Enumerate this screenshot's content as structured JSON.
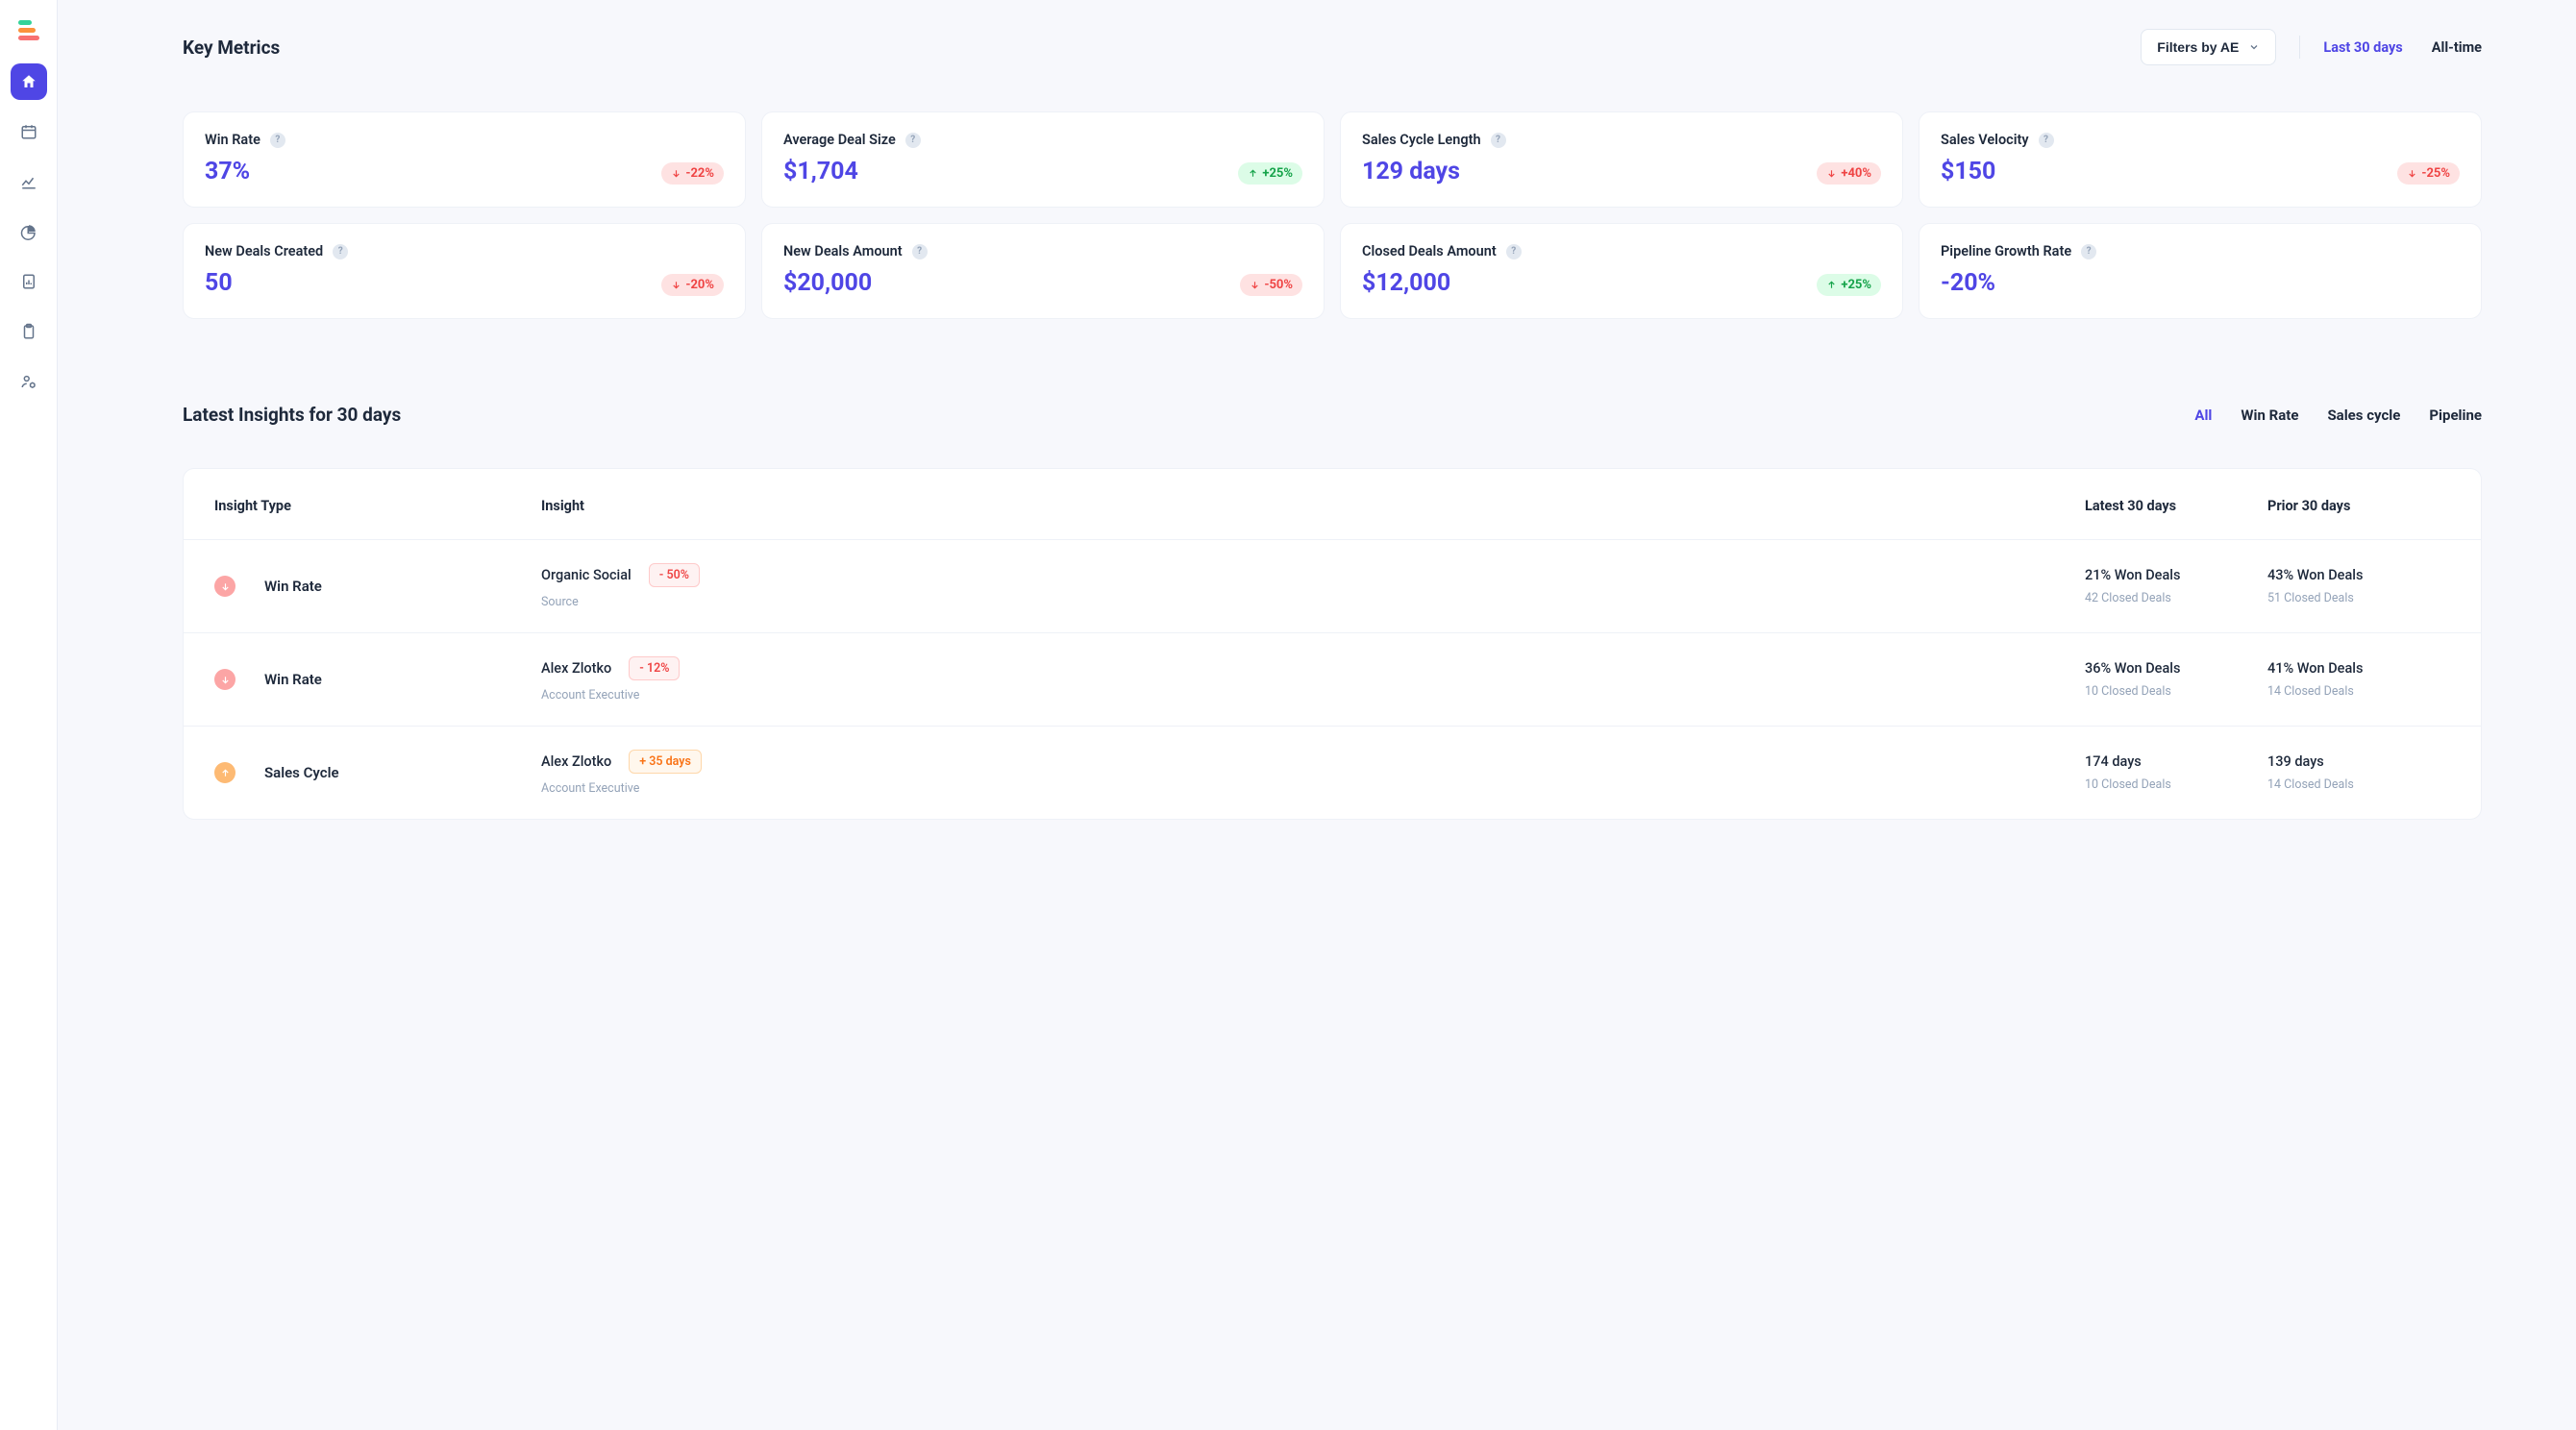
{
  "header": {
    "title": "Key Metrics",
    "filter_label": "Filters by AE",
    "time_tabs": [
      "Last 30 days",
      "All-time"
    ],
    "time_active": 0
  },
  "metrics": [
    {
      "title": "Win Rate",
      "value": "37%",
      "delta": "-22%",
      "dir": "down",
      "help": true
    },
    {
      "title": "Average Deal Size",
      "value": "$1,704",
      "delta": "+25%",
      "dir": "up",
      "help": true
    },
    {
      "title": "Sales Cycle Length",
      "value": "129 days",
      "delta": "+40%",
      "dir": "down",
      "help": true
    },
    {
      "title": "Sales Velocity",
      "value": "$150",
      "delta": "-25%",
      "dir": "down",
      "help": true
    },
    {
      "title": "New Deals Created",
      "value": "50",
      "delta": "-20%",
      "dir": "down",
      "help": true
    },
    {
      "title": "New Deals Amount",
      "value": "$20,000",
      "delta": "-50%",
      "dir": "down",
      "help": true
    },
    {
      "title": "Closed Deals Amount",
      "value": "$12,000",
      "delta": "+25%",
      "dir": "up",
      "help": true
    },
    {
      "title": "Pipeline Growth Rate",
      "value": "-20%",
      "delta": null,
      "dir": null,
      "help": true
    }
  ],
  "insights": {
    "title": "Latest Insights for 30 days",
    "tabs": [
      "All",
      "Win Rate",
      "Sales cycle",
      "Pipeline"
    ],
    "tab_active": 0,
    "columns": [
      "Insight Type",
      "Insight",
      "Latest 30 days",
      "Prior 30 days"
    ],
    "rows": [
      {
        "trend": "down",
        "type": "Win Rate",
        "name": "Organic Social",
        "sub": "Source",
        "pill": "- 50%",
        "pill_kind": "neg",
        "latest_main": "21% Won Deals",
        "latest_sub": "42 Closed Deals",
        "prior_main": "43% Won Deals",
        "prior_sub": "51 Closed Deals"
      },
      {
        "trend": "down",
        "type": "Win Rate",
        "name": "Alex Zlotko",
        "sub": "Account Executive",
        "pill": "- 12%",
        "pill_kind": "neg",
        "latest_main": "36% Won Deals",
        "latest_sub": "10 Closed Deals",
        "prior_main": "41% Won Deals",
        "prior_sub": "14 Closed Deals"
      },
      {
        "trend": "up",
        "type": "Sales Cycle",
        "name": "Alex Zlotko",
        "sub": "Account Executive",
        "pill": "+ 35 days",
        "pill_kind": "pos",
        "latest_main": "174 days",
        "latest_sub": "10 Closed Deals",
        "prior_main": "139 days",
        "prior_sub": "14 Closed Deals"
      }
    ]
  }
}
